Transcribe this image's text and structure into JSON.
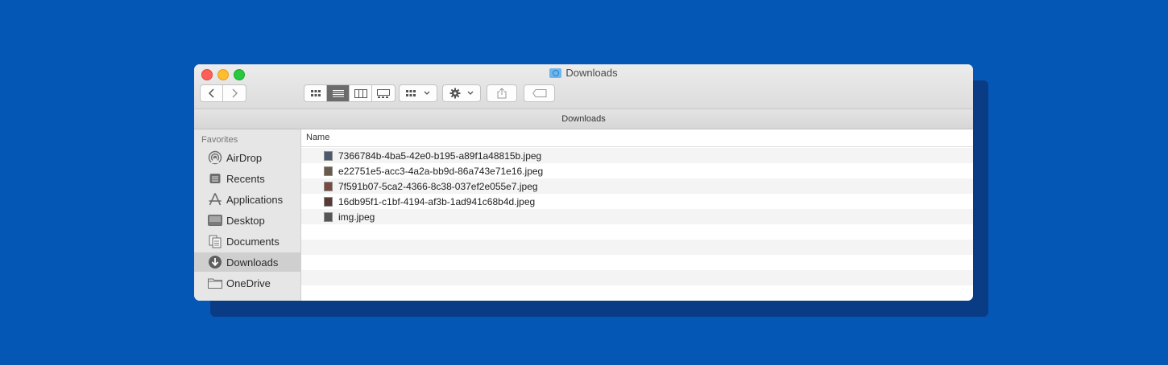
{
  "window": {
    "title": "Downloads",
    "path_label": "Downloads"
  },
  "sidebar": {
    "heading": "Favorites",
    "items": [
      {
        "label": "AirDrop",
        "icon": "airdrop-icon"
      },
      {
        "label": "Recents",
        "icon": "recents-icon"
      },
      {
        "label": "Applications",
        "icon": "applications-icon"
      },
      {
        "label": "Desktop",
        "icon": "desktop-icon"
      },
      {
        "label": "Documents",
        "icon": "documents-icon"
      },
      {
        "label": "Downloads",
        "icon": "downloads-icon",
        "selected": true
      },
      {
        "label": "OneDrive",
        "icon": "folder-icon"
      }
    ]
  },
  "list": {
    "column_name": "Name",
    "files": [
      {
        "name": "7366784b-4ba5-42e0-b195-a89f1a48815b.jpeg"
      },
      {
        "name": "e22751e5-acc3-4a2a-bb9d-86a743e71e16.jpeg"
      },
      {
        "name": "7f591b07-5ca2-4366-8c38-037ef2e055e7.jpeg"
      },
      {
        "name": "16db95f1-c1bf-4194-af3b-1ad941c68b4d.jpeg"
      },
      {
        "name": "img.jpeg"
      }
    ]
  },
  "colors": {
    "background": "#0557b6",
    "close": "#fe5f57",
    "minimize": "#febc2e",
    "maximize": "#28c840"
  }
}
